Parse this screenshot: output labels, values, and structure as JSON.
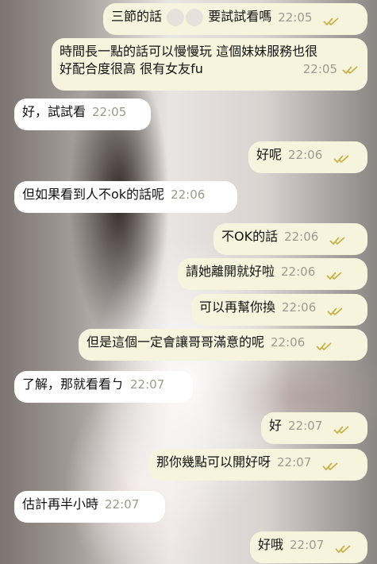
{
  "messages": [
    {
      "dir": "out",
      "text_before": "三節的話",
      "text_after": "要試試看嗎",
      "time": "22:05",
      "read_icon": "double-check-icon"
    },
    {
      "dir": "out",
      "line1": "時間長一點的話可以慢慢玩 這個妹妹服務也很",
      "line2": "好配合度很高 很有女友fu",
      "time": "22:05",
      "read_icon": "double-check-icon"
    },
    {
      "dir": "in",
      "text": "好，試試看",
      "time": "22:05"
    },
    {
      "dir": "out",
      "text": "好呢",
      "time": "22:06",
      "read_icon": "double-check-icon"
    },
    {
      "dir": "in",
      "text": "但如果看到人不ok的話呢",
      "time": "22:06"
    },
    {
      "dir": "out",
      "text": "不OK的話",
      "time": "22:06",
      "read_icon": "double-check-icon"
    },
    {
      "dir": "out",
      "text": "請她離開就好啦",
      "time": "22:06",
      "read_icon": "double-check-icon"
    },
    {
      "dir": "out",
      "text": "可以再幫你換",
      "time": "22:06",
      "read_icon": "double-check-icon"
    },
    {
      "dir": "out",
      "text": "但是這個一定會讓哥哥滿意的呢",
      "time": "22:06",
      "read_icon": "double-check-icon"
    },
    {
      "dir": "in",
      "text": "了解，那就看看ㄅ",
      "time": "22:07"
    },
    {
      "dir": "out",
      "text": "好",
      "time": "22:07",
      "read_icon": "double-check-icon"
    },
    {
      "dir": "out",
      "text": "那你幾點可以開好呀",
      "time": "22:07",
      "read_icon": "double-check-icon"
    },
    {
      "dir": "in",
      "text": "估計再半小時",
      "time": "22:07"
    },
    {
      "dir": "out",
      "text": "好哦",
      "time": "22:07",
      "read_icon": "double-check-icon"
    }
  ],
  "colors": {
    "incoming_bubble": "#ffffff",
    "outgoing_bubble": "#f7f4de",
    "time": "#9c9a8f",
    "check": "#c8b24a"
  }
}
